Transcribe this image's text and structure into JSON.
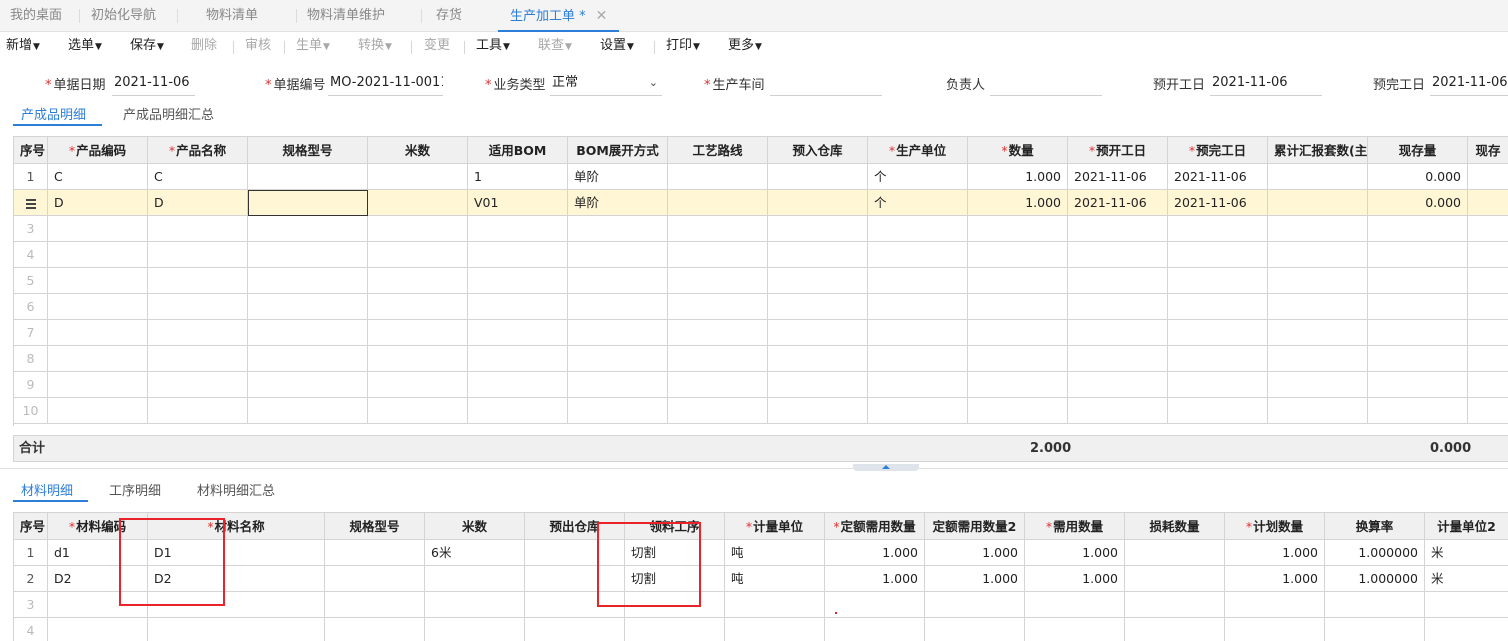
{
  "tabs": [
    {
      "label": "我的桌面"
    },
    {
      "label": "初始化导航"
    },
    {
      "label": "物料清单"
    },
    {
      "label": "物料清单维护"
    },
    {
      "label": "存货"
    },
    {
      "label": "生产加工单 *",
      "close": "✕"
    }
  ],
  "toolbar": {
    "new": "新增",
    "select": "选单",
    "save": "保存",
    "delete": "删除",
    "audit": "审核",
    "gen": "生单",
    "convert": "转换",
    "change": "变更",
    "tools": "工具",
    "link": "联查",
    "settings": "设置",
    "print": "打印",
    "more": "更多"
  },
  "header": {
    "date_label": "单据日期",
    "date_value": "2021-11-06",
    "no_label": "单据编号",
    "no_value": "MO-2021-11-0011",
    "type_label": "业务类型",
    "type_value": "正常",
    "workshop_label": "生产车间",
    "workshop_value": "",
    "owner_label": "负责人",
    "owner_value": "",
    "start_label": "预开工日",
    "start_value": "2021-11-06",
    "end_label": "预完工日",
    "end_value": "2021-11-06"
  },
  "product_tabs": {
    "detail": "产成品明细",
    "summary": "产成品明细汇总"
  },
  "product_grid": {
    "columns": [
      "序号",
      "产品编码",
      "产品名称",
      "规格型号",
      "米数",
      "适用BOM",
      "BOM展开方式",
      "工艺路线",
      "预入仓库",
      "生产单位",
      "数量",
      "预开工日",
      "预完工日",
      "累计汇报套数(主)",
      "现存量",
      "现存"
    ],
    "required": [
      false,
      true,
      true,
      false,
      false,
      false,
      false,
      false,
      false,
      true,
      true,
      true,
      true,
      false,
      false,
      false
    ],
    "rows": [
      [
        "1",
        "C",
        "C",
        "",
        "",
        "1",
        "单阶",
        "",
        "",
        "个",
        "1.000",
        "2021-11-06",
        "2021-11-06",
        "",
        "0.000",
        ""
      ],
      [
        "",
        "D",
        "D",
        "",
        "",
        "V01",
        "单阶",
        "",
        "",
        "个",
        "1.000",
        "2021-11-06",
        "2021-11-06",
        "",
        "0.000",
        ""
      ],
      [
        "3"
      ],
      [
        "4"
      ],
      [
        "5"
      ],
      [
        "6"
      ],
      [
        "7"
      ],
      [
        "8"
      ],
      [
        "9"
      ],
      [
        "10"
      ]
    ],
    "total_label": "合计",
    "total_qty": "2.000",
    "total_stock": "0.000"
  },
  "material_tabs": {
    "detail": "材料明细",
    "process": "工序明细",
    "summary": "材料明细汇总"
  },
  "material_grid": {
    "columns": [
      "序号",
      "材料编码",
      "材料名称",
      "规格型号",
      "米数",
      "预出仓库",
      "领料工序",
      "计量单位",
      "定额需用数量",
      "定额需用数量2",
      "需用数量",
      "损耗数量",
      "计划数量",
      "换算率",
      "计量单位2"
    ],
    "required": [
      false,
      true,
      true,
      false,
      false,
      false,
      false,
      true,
      true,
      false,
      true,
      false,
      true,
      false,
      false
    ],
    "rows": [
      [
        "1",
        "d1",
        "D1",
        "",
        "6米",
        "",
        "切割",
        "吨",
        "1.000",
        "1.000",
        "1.000",
        "",
        "1.000",
        "1.000000",
        "米"
      ],
      [
        "2",
        "D2",
        "D2",
        "",
        "",
        "",
        "切割",
        "吨",
        "1.000",
        "1.000",
        "1.000",
        "",
        "1.000",
        "1.000000",
        "米"
      ],
      [
        "3"
      ],
      [
        "4"
      ]
    ]
  }
}
